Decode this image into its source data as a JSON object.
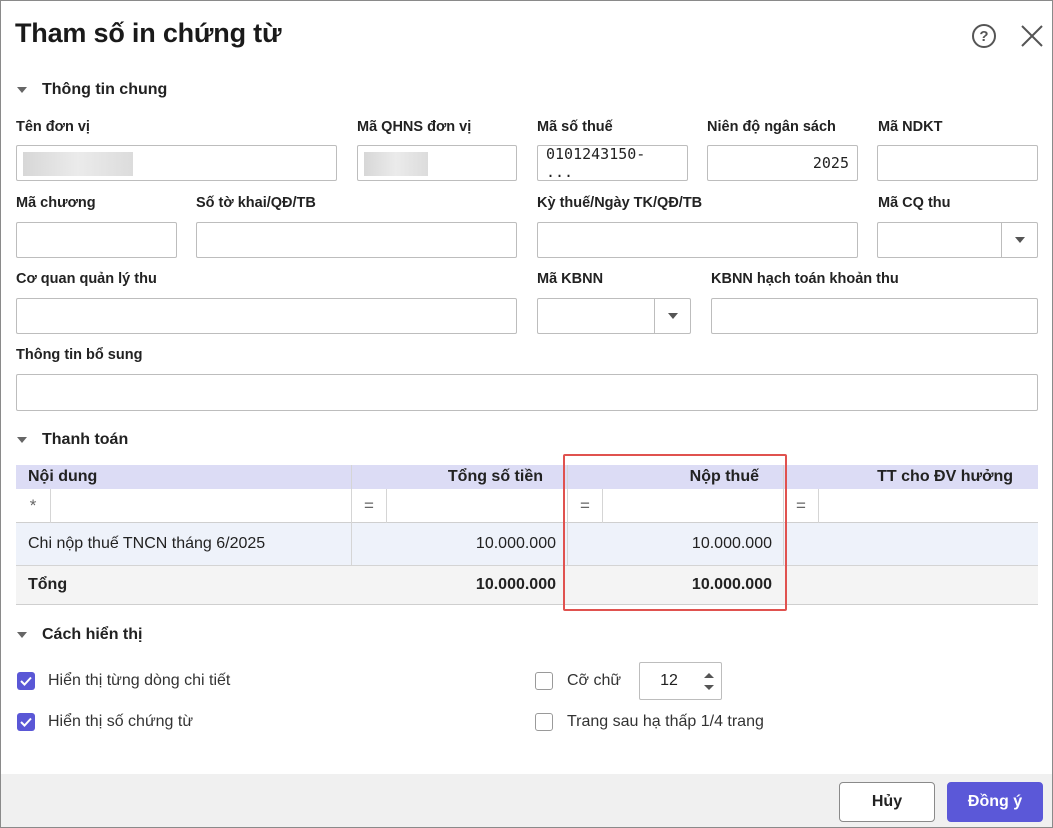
{
  "dialog": {
    "title": "Tham số in chứng từ",
    "help_glyph": "?",
    "close_icon": "close-icon"
  },
  "general": {
    "section_title": "Thông tin chung",
    "fields": {
      "ten_don_vi": {
        "label": "Tên đơn vị",
        "value": ""
      },
      "ma_qhns": {
        "label": "Mã QHNS đơn vị",
        "value": ""
      },
      "ma_so_thue": {
        "label": "Mã số thuế",
        "value": "0101243150- ..."
      },
      "nien_do": {
        "label": "Niên độ ngân sách",
        "value": "2025"
      },
      "ma_ndkt": {
        "label": "Mã NDKT",
        "value": ""
      },
      "ma_chuong": {
        "label": "Mã chương",
        "value": ""
      },
      "so_to_khai": {
        "label": "Số tờ khai/QĐ/TB",
        "value": ""
      },
      "ky_thue": {
        "label": "Kỳ thuế/Ngày TK/QĐ/TB",
        "value": ""
      },
      "ma_cq_thu": {
        "label": "Mã CQ thu",
        "value": ""
      },
      "co_quan_ql_thu": {
        "label": "Cơ quan quản lý thu",
        "value": ""
      },
      "ma_kbnn": {
        "label": "Mã KBNN",
        "value": ""
      },
      "kbnn_hach_toan": {
        "label": "KBNN hạch toán khoản thu",
        "value": ""
      },
      "thong_tin_bo_sung": {
        "label": "Thông tin bổ sung",
        "value": ""
      }
    }
  },
  "payment": {
    "section_title": "Thanh toán",
    "columns": [
      "Nội dung",
      "Tổng số tiền",
      "Nộp thuế",
      "TT cho ĐV hưởng"
    ],
    "filter_symbols": [
      "*",
      "=",
      "=",
      "="
    ],
    "rows": [
      {
        "noi_dung": "Chi nộp thuế TNCN tháng 6/2025",
        "tong_so_tien": "10.000.000",
        "nop_thue": "10.000.000",
        "tt_dv_huong": ""
      }
    ],
    "total": {
      "label": "Tổng",
      "tong_so_tien": "10.000.000",
      "nop_thue": "10.000.000",
      "tt_dv_huong": ""
    }
  },
  "display": {
    "section_title": "Cách hiển thị",
    "options": {
      "show_detail_lines": {
        "label": "Hiển thị từng dòng chi tiết",
        "checked": true
      },
      "show_doc_number": {
        "label": "Hiển thị số chứng từ",
        "checked": true
      },
      "font_size": {
        "label": "Cỡ chữ",
        "checked": false,
        "value": "12"
      },
      "lower_quarter": {
        "label": "Trang sau hạ thấp 1/4 trang",
        "checked": false
      }
    }
  },
  "footer": {
    "cancel_label": "Hủy",
    "ok_label": "Đồng ý"
  },
  "colors": {
    "accent": "#5b58d8",
    "grid_header": "#dcdcf5",
    "highlight_box": "#e0524f"
  }
}
